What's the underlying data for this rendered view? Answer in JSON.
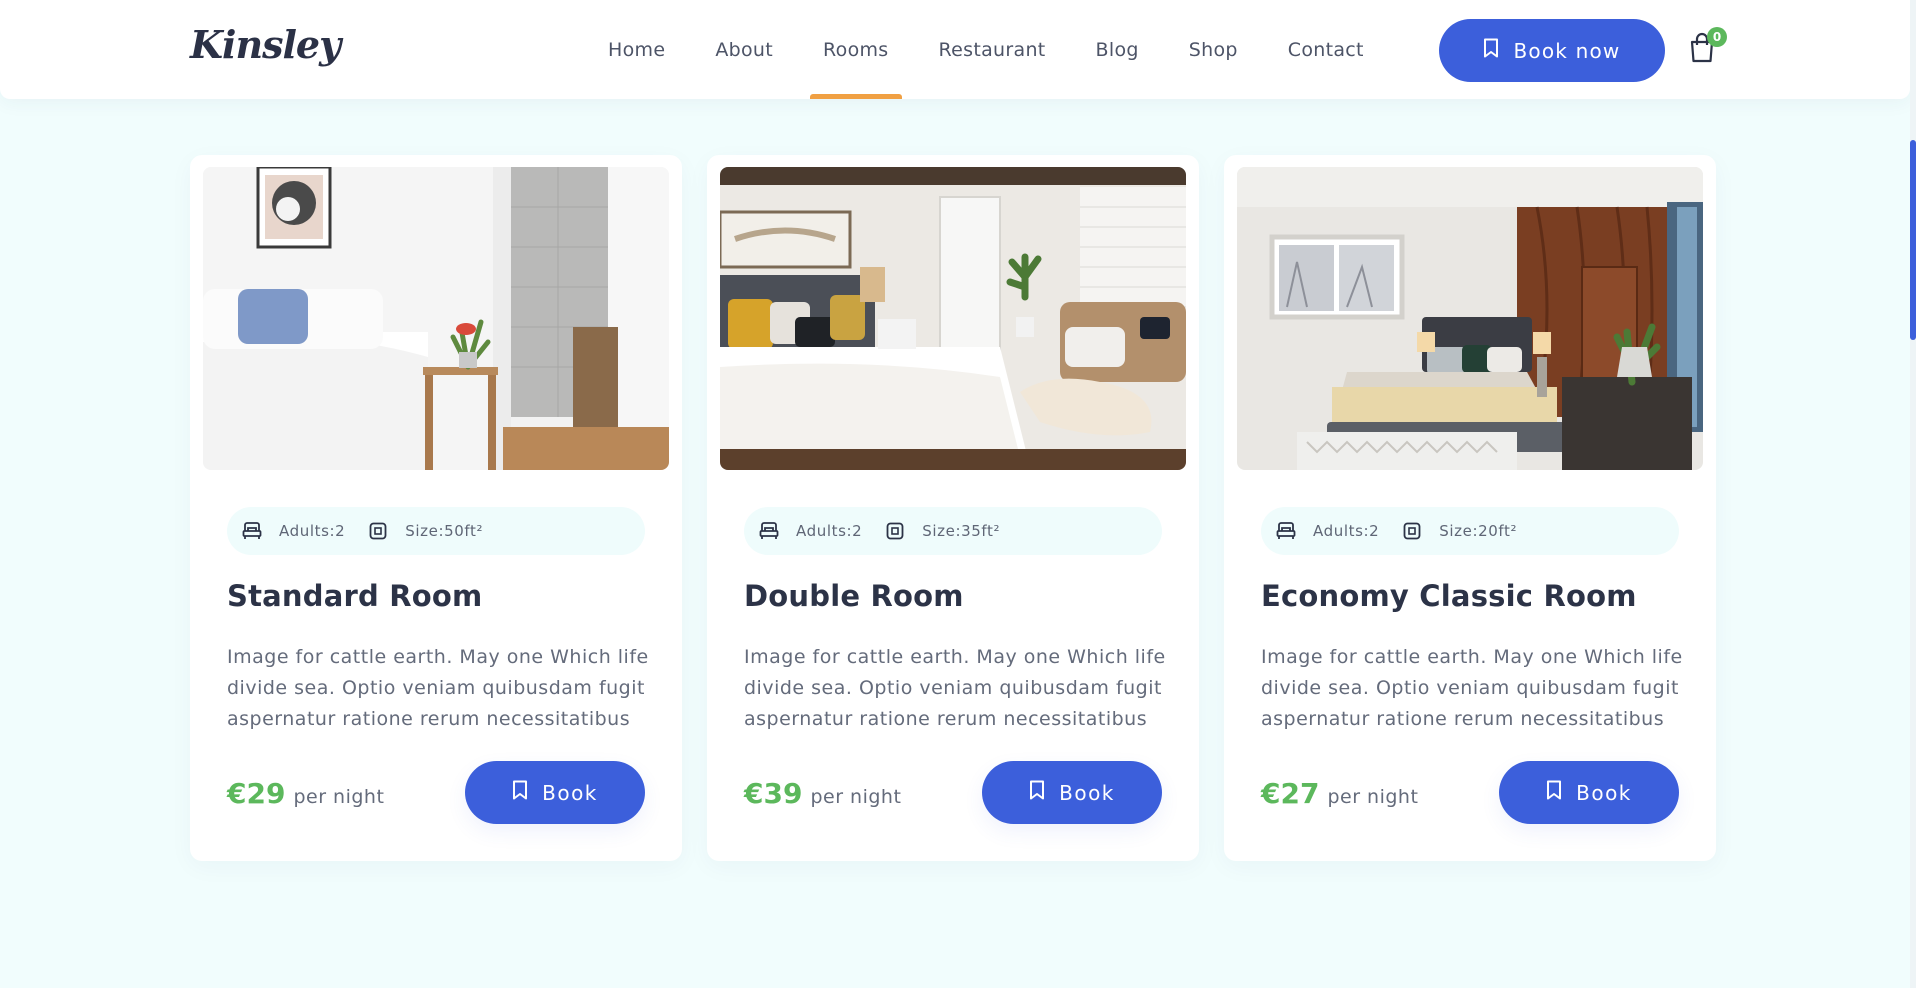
{
  "header": {
    "logo": "Kinsley",
    "nav": [
      "Home",
      "About",
      "Rooms",
      "Restaurant",
      "Blog",
      "Shop",
      "Contact"
    ],
    "active_nav": "Rooms",
    "book_now_label": "Book now",
    "cart_count": "0"
  },
  "colors": {
    "accent": "#3c5fdb",
    "price_green": "#5cb85c",
    "active_underline": "#f0a043",
    "page_bg": "#f1fdfd"
  },
  "icons": {
    "book_button": "bookmark-icon",
    "cart": "shopping-bag-icon",
    "adults": "bed-icon",
    "size": "square-size-icon"
  },
  "rooms": [
    {
      "title": "Standard Room",
      "adults": "Adults:2",
      "size": "Size:50ft²",
      "description": "Image for cattle earth. May one Which life divide sea. Optio veniam quibusdam fugit aspernatur ratione rerum necessitatibus ips...",
      "price": "€29",
      "price_unit": "per night",
      "book_label": "Book"
    },
    {
      "title": "Double Room",
      "adults": "Adults:2",
      "size": "Size:35ft²",
      "description": "Image for cattle earth. May one Which life divide sea. Optio veniam quibusdam fugit aspernatur ratione rerum necessitatibus ips...",
      "price": "€39",
      "price_unit": "per night",
      "book_label": "Book"
    },
    {
      "title": "Economy Classic Room",
      "adults": "Adults:2",
      "size": "Size:20ft²",
      "description": "Image for cattle earth. May one Which life divide sea. Optio veniam quibusdam fugit aspernatur ratione rerum necessitatibus ips...",
      "price": "€27",
      "price_unit": "per night",
      "book_label": "Book"
    }
  ]
}
